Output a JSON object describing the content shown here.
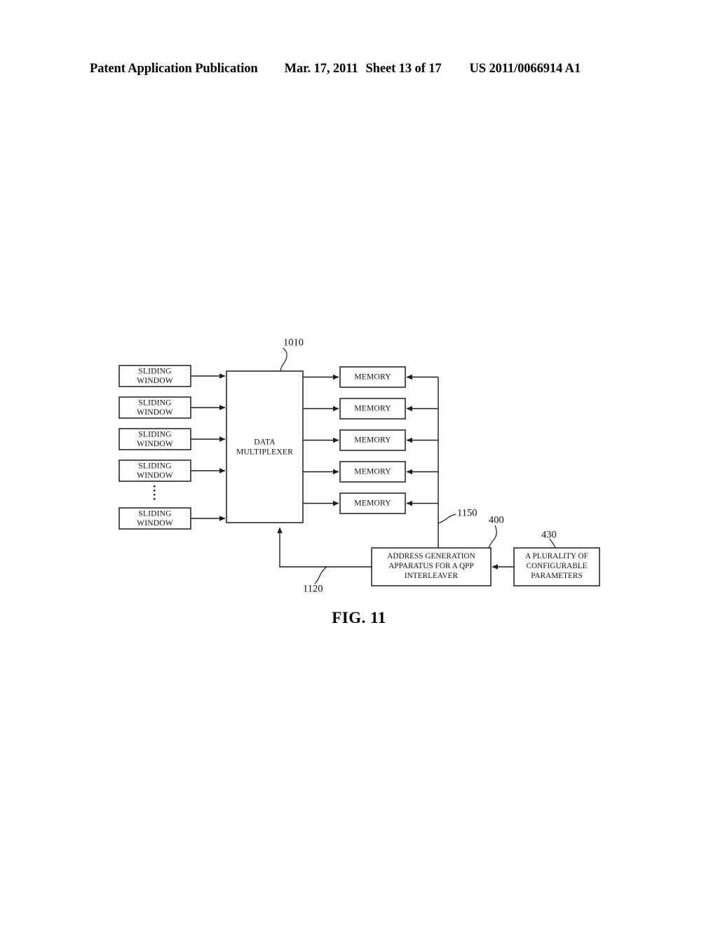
{
  "header": {
    "publication": "Patent Application Publication",
    "date": "Mar. 17, 2011",
    "sheet": "Sheet 13 of 17",
    "publication_number": "US 2011/0066914 A1"
  },
  "figure": {
    "caption": "FIG. 11",
    "blocks": {
      "sliding_window": {
        "line1": "SLIDING",
        "line2": "WINDOW",
        "count": 5
      },
      "data_multiplexer": {
        "line1": "DATA",
        "line2": "MULTIPLEXER"
      },
      "memory": {
        "label": "MEMORY",
        "count": 5
      },
      "address_generation": {
        "line1": "ADDRESS GENERATION",
        "line2": "APPARATUS FOR A QPP",
        "line3": "INTERLEAVER"
      },
      "configurable_parameters": {
        "line1": "A PLURALITY OF",
        "line2": "CONFIGURABLE",
        "line3": "PARAMETERS"
      }
    },
    "reference_numerals": {
      "data_multiplexer": "1010",
      "memory_bus": "1150",
      "address_generation": "400",
      "configurable_parameters": "430",
      "control_feedback": "1120"
    }
  },
  "colors": {
    "ink": "#1b1b1b",
    "paper": "#ffffff"
  }
}
